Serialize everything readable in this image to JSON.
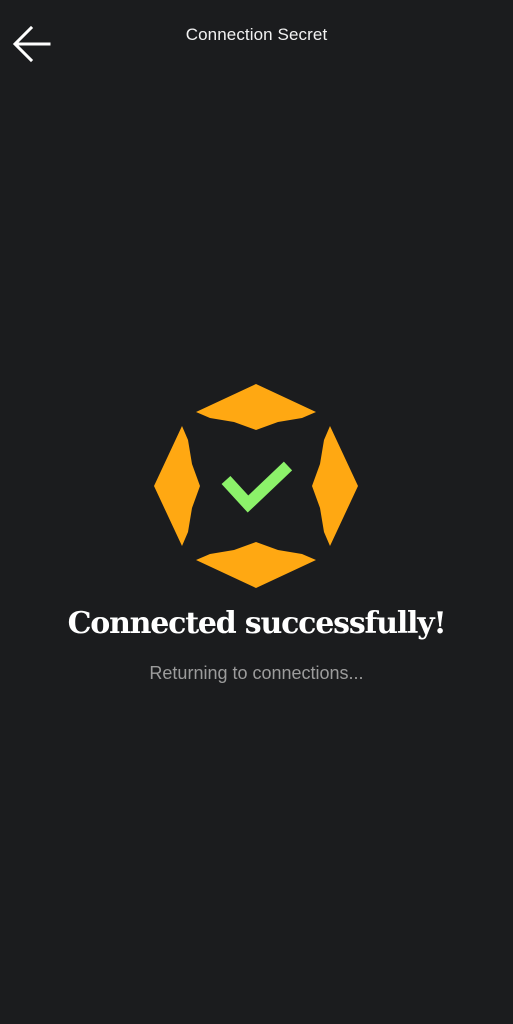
{
  "header": {
    "title": "Connection Secret",
    "back_icon": "arrow-left-icon"
  },
  "status": {
    "heading": "Connected successfully!",
    "subtext": "Returning to connections...",
    "icon": "success-checkmark-icon"
  },
  "colors": {
    "background": "#1b1c1e",
    "logo": "#ffa812",
    "check": "#8cf26a",
    "subtext": "#9c9c9c"
  }
}
